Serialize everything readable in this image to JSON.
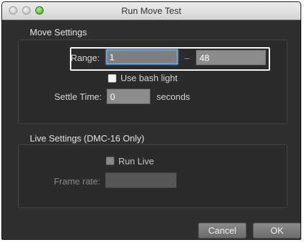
{
  "window": {
    "title": "Run Move Test"
  },
  "move_settings": {
    "group_title": "Move Settings",
    "range_label": "Range:",
    "range_start": "1",
    "range_separator": "–",
    "range_end": "48",
    "bash_light_label": "Use bash light",
    "bash_light_checked": false,
    "settle_time_label": "Settle Time:",
    "settle_time_value": "0",
    "settle_time_unit": "seconds"
  },
  "live_settings": {
    "group_title": "Live Settings (DMC-16 Only)",
    "run_live_label": "Run Live",
    "run_live_checked": false,
    "run_live_enabled": false,
    "frame_rate_label": "Frame rate:",
    "frame_rate_value": ""
  },
  "buttons": {
    "cancel_label": "Cancel",
    "ok_label": "OK"
  },
  "colors": {
    "window_background": "#2f2f2f",
    "focus_ring": "#6ca1d9",
    "highlight_frame": "#ffffff"
  }
}
